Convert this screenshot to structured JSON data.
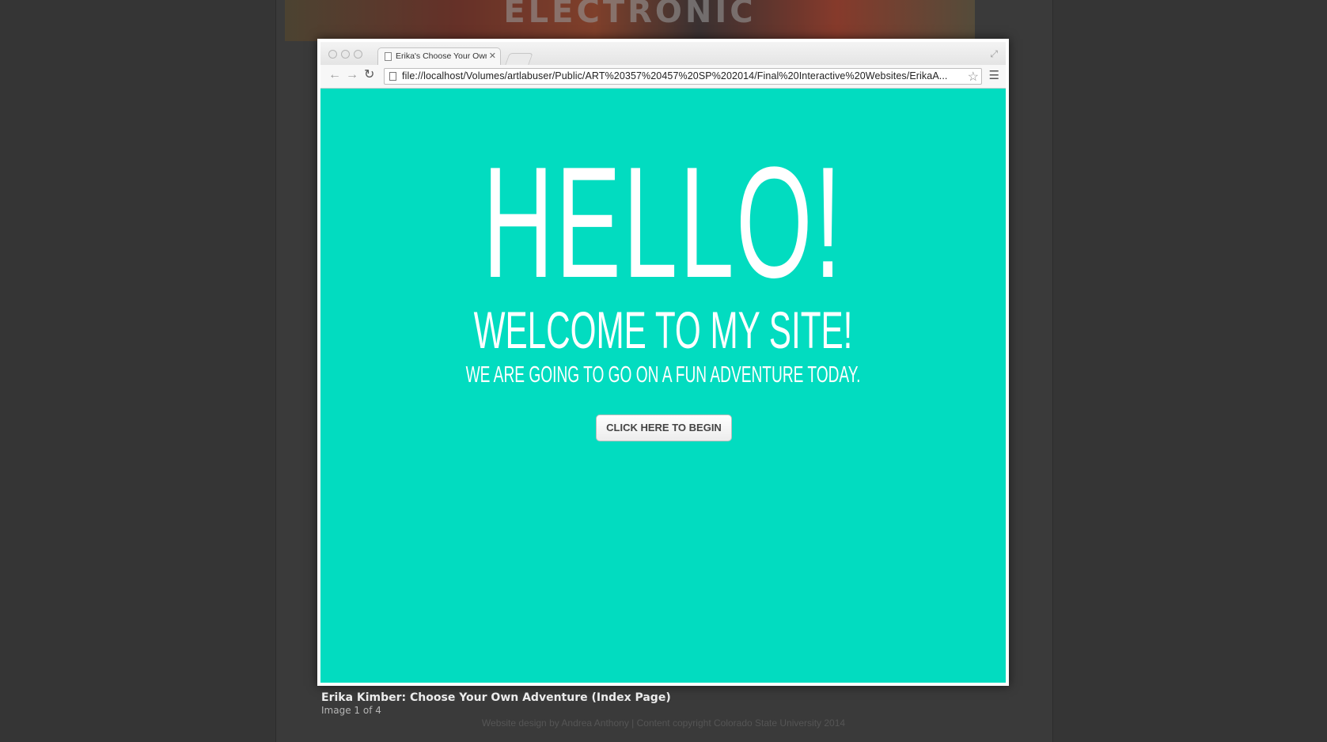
{
  "background_site": {
    "banner_text": "ELECTRONIC",
    "footer_credit": "Website design by Andrea Anthony | Content copyright Colorado State University 2014"
  },
  "browser": {
    "tab_title": "Erika's Choose Your Own Adventure",
    "url": "file://localhost/Volumes/artlabuser/Public/ART%20357%20457%20SP%202014/Final%20Interactive%20Websites/ErikaA..."
  },
  "page": {
    "hello": "HELLO!",
    "welcome": "WELCOME TO MY SITE!",
    "subtitle": "WE ARE GOING TO GO ON A FUN ADVENTURE TODAY.",
    "button_label": "CLICK HERE TO BEGIN",
    "background_color": "#02dcc0"
  },
  "caption": {
    "title": "Erika Kimber: Choose Your Own Adventure (Index Page)",
    "counter": "Image 1 of 4"
  },
  "icons": [
    "back-arrow-icon",
    "forward-arrow-icon",
    "reload-icon",
    "page-icon",
    "star-icon",
    "menu-icon",
    "close-icon",
    "fullscreen-icon"
  ]
}
